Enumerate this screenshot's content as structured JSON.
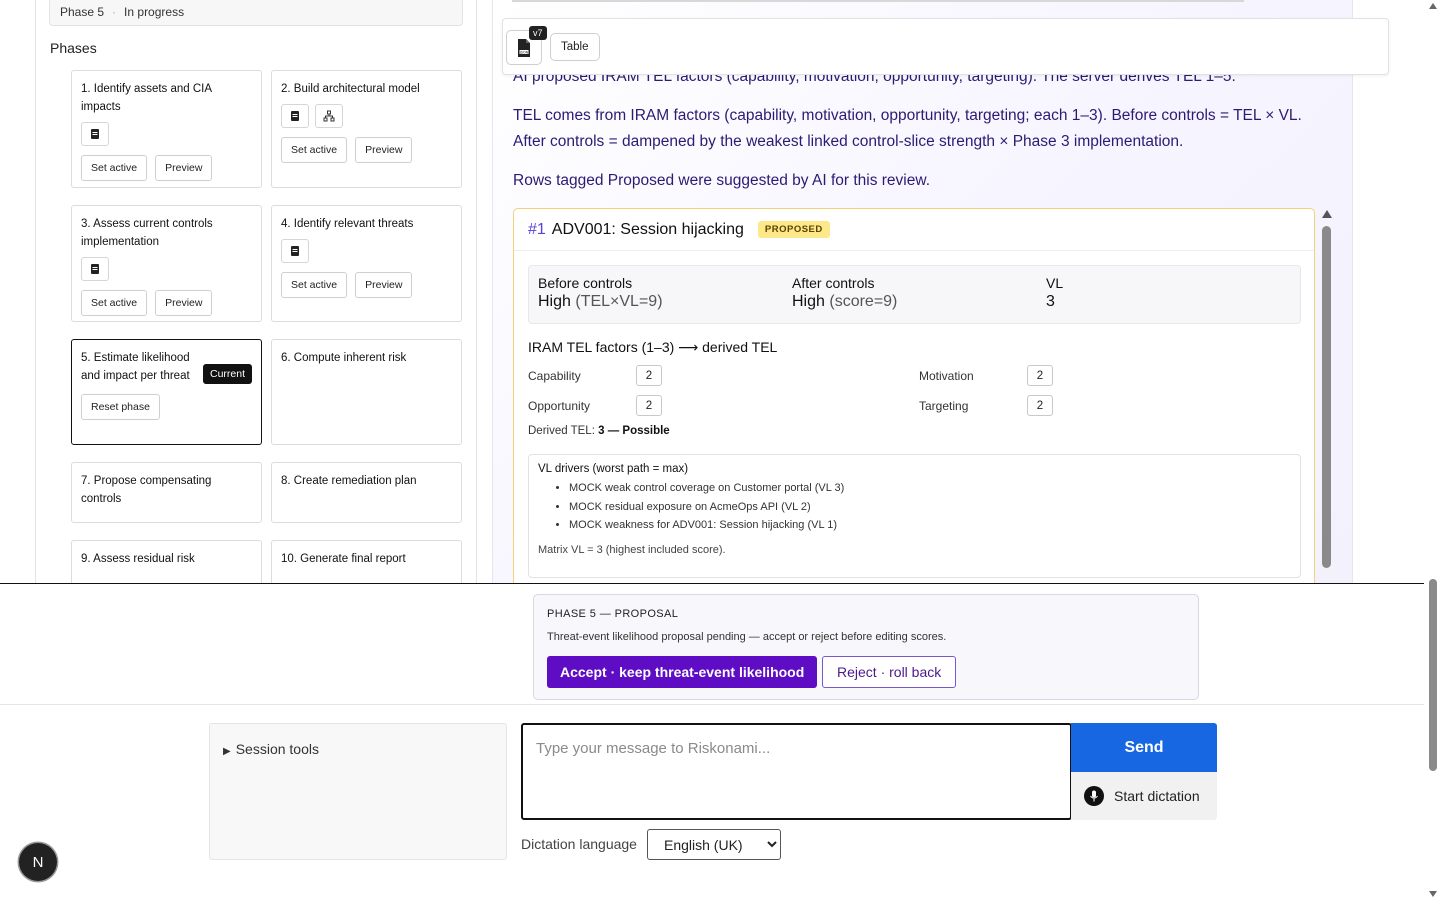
{
  "sidebar": {
    "status": {
      "phase": "Phase 5",
      "state": "In progress"
    },
    "phases_heading": "Phases",
    "cards": [
      {
        "title": "1. Identify assets and CIA impacts",
        "set_active": "Set active",
        "preview": "Preview"
      },
      {
        "title": "2. Build architectural model",
        "set_active": "Set active",
        "preview": "Preview"
      },
      {
        "title": "3. Assess current controls implementation",
        "set_active": "Set active",
        "preview": "Preview"
      },
      {
        "title": "4. Identify relevant threats",
        "set_active": "Set active",
        "preview": "Preview"
      },
      {
        "title": "5. Estimate likelihood and impact per threat",
        "badge": "Current",
        "reset": "Reset phase"
      },
      {
        "title": "6. Compute inherent risk"
      },
      {
        "title": "7. Propose compensating controls"
      },
      {
        "title": "8. Create remediation plan"
      },
      {
        "title": "9. Assess residual risk"
      },
      {
        "title": "10. Generate final report"
      }
    ]
  },
  "toolbar": {
    "version": "v7",
    "json_icon": "json-file-icon",
    "table_label": "Table"
  },
  "main": {
    "intro_cut": "AI proposed IRAM TEL factors (capability, motivation, opportunity, targeting). The server derives TEL 1–5.",
    "tel_explain": "TEL comes from IRAM factors (capability, motivation, opportunity, targeting; each 1–3). Before controls = TEL × VL. After controls = dampened by the weakest linked control-slice strength × Phase 3 implementation.",
    "proposed_note": "Rows tagged Proposed were suggested by AI for this review."
  },
  "threat": {
    "number": "#1",
    "title": "ADV001: Session hijacking",
    "badge": "PROPOSED",
    "before_label": "Before controls",
    "before_value": "High",
    "before_detail": "(TEL×VL=9)",
    "after_label": "After controls",
    "after_value": "High",
    "after_detail": "(score=9)",
    "vl_label": "VL",
    "vl_value": "3",
    "iram_heading": "IRAM TEL factors (1–3) ⟶ derived TEL",
    "factors": {
      "capability": {
        "label": "Capability",
        "value": "2"
      },
      "motivation": {
        "label": "Motivation",
        "value": "2"
      },
      "opportunity": {
        "label": "Opportunity",
        "value": "2"
      },
      "targeting": {
        "label": "Targeting",
        "value": "2"
      }
    },
    "derived_label": "Derived TEL:",
    "derived_value": "3 — Possible",
    "drivers_title": "VL drivers (worst path = max)",
    "drivers": [
      "MOCK weak control coverage on Customer portal (VL 3)",
      "MOCK residual exposure on AcmeOps API (VL 2)",
      "MOCK weakness for ADV001: Session hijacking (VL 1)"
    ],
    "matrix_note": "Matrix VL = 3 (highest included score)."
  },
  "proposal": {
    "title": "PHASE 5 — PROPOSAL",
    "text": "Threat-event likelihood proposal pending — accept or reject before editing scores.",
    "accept": "Accept · keep threat-event likelihood",
    "reject": "Reject · roll back"
  },
  "composer": {
    "session_tools": "Session tools",
    "placeholder": "Type your message to Riskonami...",
    "send": "Send",
    "dictation": "Start dictation",
    "language_label": "Dictation language",
    "language_selected": "English (UK)"
  },
  "avatar_initial": "N",
  "colors": {
    "accent_purple": "#5e0dc4",
    "send_blue": "#1766e2",
    "proposed_yellow": "#fde98a",
    "text_purple": "#2d1a73"
  }
}
